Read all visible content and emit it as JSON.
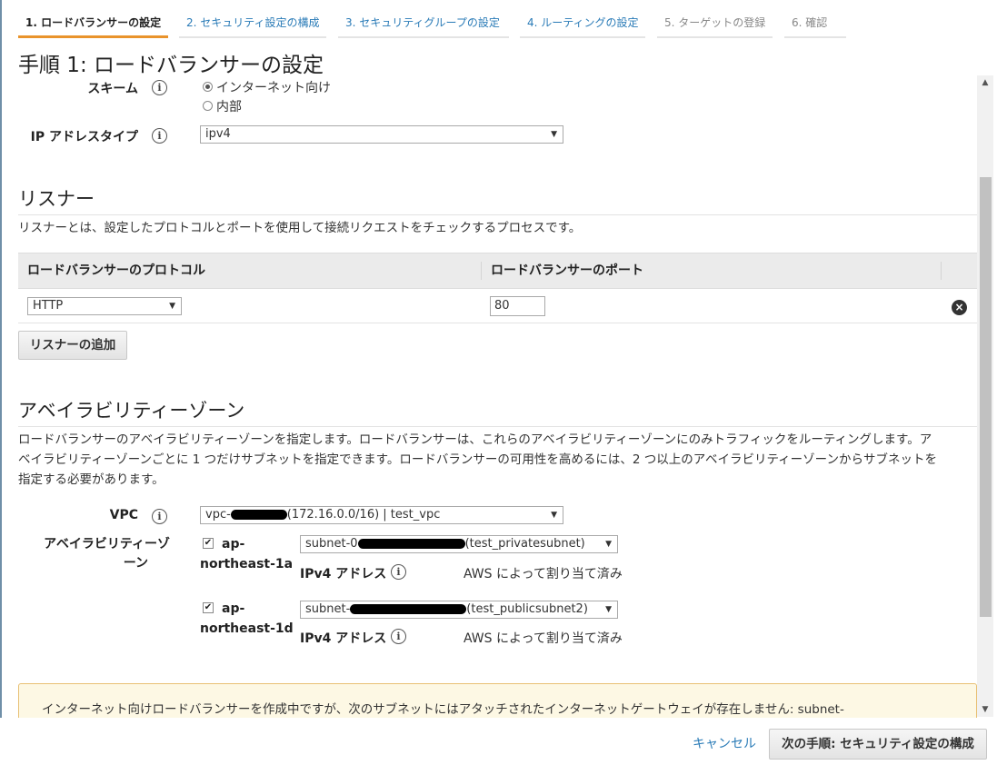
{
  "steps": [
    {
      "label": "1. ロードバランサーの設定",
      "state": "active"
    },
    {
      "label": "2. セキュリティ設定の構成",
      "state": "link"
    },
    {
      "label": "3. セキュリティグループの設定",
      "state": "link"
    },
    {
      "label": "4. ルーティングの設定",
      "state": "link"
    },
    {
      "label": "5. ターゲットの登録",
      "state": "future"
    },
    {
      "label": "6. 確認",
      "state": "future"
    }
  ],
  "page_title": "手順 1: ロードバランサーの設定",
  "basic": {
    "scheme_label": "スキーム",
    "scheme_options": [
      {
        "label": "インターネット向け",
        "selected": true
      },
      {
        "label": "内部",
        "selected": false
      }
    ],
    "ip_type_label": "IP アドレスタイプ",
    "ip_type_value": "ipv4"
  },
  "listeners": {
    "title": "リスナー",
    "description": "リスナーとは、設定したプロトコルとポートを使用して接続リクエストをチェックするプロセスです。",
    "col_protocol": "ロードバランサーのプロトコル",
    "col_port": "ロードバランサーのポート",
    "rows": [
      {
        "protocol": "HTTP",
        "port": "80"
      }
    ],
    "add_button": "リスナーの追加"
  },
  "az": {
    "title": "アベイラビリティーゾーン",
    "description_lines": [
      "ロードバランサーのアベイラビリティーゾーンを指定します。ロードバランサーは、これらのアベイラビリティーゾーンにのみトラフィックをルーティングします。ア",
      "ベイラビリティーゾーンごとに 1 つだけサブネットを指定できます。ロードバランサーの可用性を高めるには、2 つ以上のアベイラビリティーゾーンからサブネットを",
      "指定する必要があります。"
    ],
    "vpc_label": "VPC",
    "vpc_prefix": "vpc-",
    "vpc_suffix": "(172.16.0.0/16) | test_vpc",
    "az_label_line1": "アベイラビリティーゾ",
    "az_label_line2": "ーン",
    "zones": [
      {
        "name_line1": "ap-",
        "name_line2": "northeast-1a",
        "checked": true,
        "subnet_prefix": "subnet-0",
        "subnet_suffix": "(test_privatesubnet)",
        "ipv4_label": "IPv4 アドレス",
        "ipv4_value": "AWS によって割り当て済み"
      },
      {
        "name_line1": "ap-",
        "name_line2": "northeast-1d",
        "checked": true,
        "subnet_prefix": "subnet-",
        "subnet_suffix": "(test_publicsubnet2)",
        "ipv4_label": "IPv4 アドレス",
        "ipv4_value": "AWS によって割り当て済み"
      }
    ]
  },
  "warning": {
    "text": "インターネット向けロードバランサーを作成中ですが、次のサブネットにはアタッチされたインターネットゲートウェイが存在しません: subnet-"
  },
  "footer": {
    "cancel": "キャンセル",
    "next": "次の手順: セキュリティ設定の構成"
  },
  "colors": {
    "link": "#2a7bb7",
    "active_tab_underline": "#e9932b",
    "warning_bg": "#fdf8e4",
    "warning_border": "#e8c074"
  }
}
